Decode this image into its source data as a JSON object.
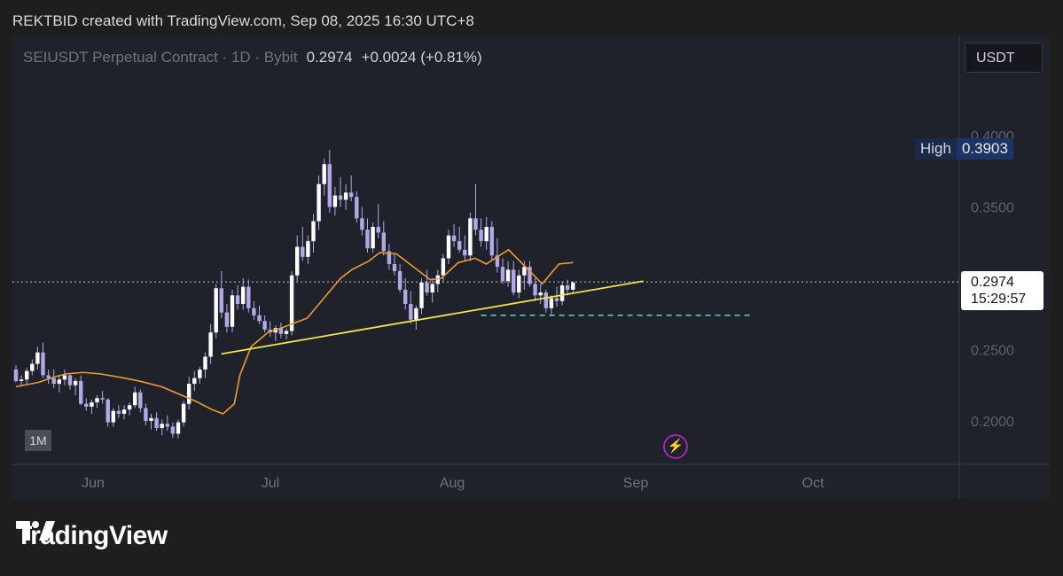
{
  "attribution": "REKTBID created with TradingView.com, Sep 08, 2025 16:30 UTC+8",
  "legend": {
    "symbol": "SEIUSDT Perpetual Contract · 1D · Bybit",
    "price": "0.2974",
    "change": "+0.0024 (+0.81%)"
  },
  "currency": "USDT",
  "high_label": "High",
  "high_value": "0.3903",
  "last_price": "0.2974",
  "countdown": "15:29:57",
  "zoom_label": "1M",
  "brand": "TradingView",
  "icons": [
    "bolt-icon",
    "tradingview-logo-icon"
  ],
  "colors": {
    "candle": "#b2a8e6",
    "ma": "#ef9a2c",
    "trendline": "#f4e34d",
    "support": "#3ed6c4",
    "price_line": "#c7c9cf"
  },
  "chart_data": {
    "type": "candlestick",
    "title": "SEIUSDT Perpetual Contract · 1D · Bybit",
    "xlabel": "",
    "ylabel": "",
    "ylim": [
      0.18,
      0.43
    ],
    "x_ticks": [
      "Jun",
      "Jul",
      "Aug",
      "Sep",
      "Oct"
    ],
    "y_ticks": [
      "0.4000",
      "0.3500",
      "0.2500",
      "0.2000"
    ],
    "grid": false,
    "series": [
      {
        "name": "",
        "type": "candle",
        "values": [
          [
            0.236,
            0.239,
            0.227,
            0.228
          ],
          [
            0.228,
            0.232,
            0.224,
            0.229
          ],
          [
            0.229,
            0.237,
            0.226,
            0.235
          ],
          [
            0.235,
            0.243,
            0.232,
            0.24
          ],
          [
            0.24,
            0.252,
            0.236,
            0.248
          ],
          [
            0.248,
            0.255,
            0.23,
            0.232
          ],
          [
            0.232,
            0.236,
            0.226,
            0.23
          ],
          [
            0.23,
            0.236,
            0.223,
            0.226
          ],
          [
            0.226,
            0.232,
            0.22,
            0.229
          ],
          [
            0.229,
            0.236,
            0.225,
            0.232
          ],
          [
            0.232,
            0.233,
            0.222,
            0.225
          ],
          [
            0.225,
            0.23,
            0.218,
            0.228
          ],
          [
            0.228,
            0.232,
            0.211,
            0.212
          ],
          [
            0.212,
            0.216,
            0.207,
            0.21
          ],
          [
            0.21,
            0.215,
            0.205,
            0.213
          ],
          [
            0.213,
            0.218,
            0.209,
            0.216
          ],
          [
            0.216,
            0.221,
            0.212,
            0.215
          ],
          [
            0.215,
            0.216,
            0.196,
            0.199
          ],
          [
            0.199,
            0.209,
            0.196,
            0.207
          ],
          [
            0.207,
            0.211,
            0.202,
            0.205
          ],
          [
            0.205,
            0.211,
            0.201,
            0.208
          ],
          [
            0.208,
            0.213,
            0.204,
            0.211
          ],
          [
            0.211,
            0.224,
            0.209,
            0.22
          ],
          [
            0.22,
            0.222,
            0.206,
            0.209
          ],
          [
            0.209,
            0.212,
            0.197,
            0.2
          ],
          [
            0.2,
            0.205,
            0.194,
            0.202
          ],
          [
            0.202,
            0.206,
            0.193,
            0.195
          ],
          [
            0.195,
            0.201,
            0.19,
            0.198
          ],
          [
            0.198,
            0.204,
            0.193,
            0.196
          ],
          [
            0.196,
            0.199,
            0.188,
            0.191
          ],
          [
            0.191,
            0.201,
            0.188,
            0.199
          ],
          [
            0.199,
            0.214,
            0.196,
            0.212
          ],
          [
            0.212,
            0.231,
            0.208,
            0.226
          ],
          [
            0.226,
            0.235,
            0.221,
            0.23
          ],
          [
            0.23,
            0.238,
            0.226,
            0.236
          ],
          [
            0.236,
            0.248,
            0.23,
            0.245
          ],
          [
            0.245,
            0.268,
            0.24,
            0.262
          ],
          [
            0.262,
            0.296,
            0.258,
            0.293
          ],
          [
            0.293,
            0.305,
            0.272,
            0.276
          ],
          [
            0.276,
            0.282,
            0.262,
            0.266
          ],
          [
            0.266,
            0.292,
            0.262,
            0.288
          ],
          [
            0.288,
            0.295,
            0.278,
            0.282
          ],
          [
            0.282,
            0.3,
            0.278,
            0.294
          ],
          [
            0.294,
            0.299,
            0.276,
            0.279
          ],
          [
            0.279,
            0.284,
            0.271,
            0.274
          ],
          [
            0.274,
            0.281,
            0.268,
            0.27
          ],
          [
            0.27,
            0.274,
            0.262,
            0.264
          ],
          [
            0.264,
            0.27,
            0.259,
            0.262
          ],
          [
            0.262,
            0.267,
            0.256,
            0.265
          ],
          [
            0.265,
            0.269,
            0.258,
            0.261
          ],
          [
            0.261,
            0.265,
            0.257,
            0.263
          ],
          [
            0.263,
            0.305,
            0.26,
            0.302
          ],
          [
            0.302,
            0.33,
            0.298,
            0.322
          ],
          [
            0.322,
            0.336,
            0.312,
            0.315
          ],
          [
            0.315,
            0.33,
            0.31,
            0.326
          ],
          [
            0.326,
            0.345,
            0.318,
            0.34
          ],
          [
            0.34,
            0.372,
            0.334,
            0.366
          ],
          [
            0.366,
            0.384,
            0.358,
            0.38
          ],
          [
            0.38,
            0.39,
            0.346,
            0.35
          ],
          [
            0.35,
            0.364,
            0.344,
            0.358
          ],
          [
            0.358,
            0.371,
            0.35,
            0.355
          ],
          [
            0.355,
            0.366,
            0.348,
            0.36
          ],
          [
            0.36,
            0.372,
            0.354,
            0.357
          ],
          [
            0.357,
            0.361,
            0.339,
            0.342
          ],
          [
            0.342,
            0.35,
            0.33,
            0.334
          ],
          [
            0.334,
            0.342,
            0.318,
            0.321
          ],
          [
            0.321,
            0.339,
            0.318,
            0.336
          ],
          [
            0.336,
            0.352,
            0.328,
            0.332
          ],
          [
            0.332,
            0.34,
            0.316,
            0.319
          ],
          [
            0.319,
            0.324,
            0.306,
            0.31
          ],
          [
            0.31,
            0.318,
            0.302,
            0.305
          ],
          [
            0.305,
            0.31,
            0.29,
            0.292
          ],
          [
            0.292,
            0.3,
            0.278,
            0.282
          ],
          [
            0.282,
            0.291,
            0.268,
            0.271
          ],
          [
            0.271,
            0.281,
            0.264,
            0.279
          ],
          [
            0.279,
            0.3,
            0.275,
            0.297
          ],
          [
            0.297,
            0.306,
            0.288,
            0.29
          ],
          [
            0.29,
            0.3,
            0.283,
            0.296
          ],
          [
            0.296,
            0.306,
            0.29,
            0.302
          ],
          [
            0.302,
            0.317,
            0.298,
            0.314
          ],
          [
            0.314,
            0.334,
            0.31,
            0.33
          ],
          [
            0.33,
            0.338,
            0.322,
            0.326
          ],
          [
            0.326,
            0.336,
            0.318,
            0.32
          ],
          [
            0.32,
            0.33,
            0.312,
            0.316
          ],
          [
            0.316,
            0.346,
            0.312,
            0.342
          ],
          [
            0.342,
            0.366,
            0.33,
            0.334
          ],
          [
            0.334,
            0.342,
            0.322,
            0.326
          ],
          [
            0.326,
            0.343,
            0.32,
            0.336
          ],
          [
            0.336,
            0.34,
            0.312,
            0.316
          ],
          [
            0.316,
            0.328,
            0.304,
            0.308
          ],
          [
            0.308,
            0.314,
            0.296,
            0.298
          ],
          [
            0.298,
            0.312,
            0.294,
            0.306
          ],
          [
            0.306,
            0.312,
            0.288,
            0.29
          ],
          [
            0.29,
            0.306,
            0.286,
            0.302
          ],
          [
            0.302,
            0.312,
            0.292,
            0.308
          ],
          [
            0.308,
            0.312,
            0.294,
            0.296
          ],
          [
            0.296,
            0.3,
            0.284,
            0.288
          ],
          [
            0.288,
            0.296,
            0.282,
            0.29
          ],
          [
            0.29,
            0.292,
            0.276,
            0.279
          ],
          [
            0.279,
            0.288,
            0.274,
            0.286
          ],
          [
            0.286,
            0.294,
            0.28,
            0.284
          ],
          [
            0.284,
            0.298,
            0.281,
            0.295
          ],
          [
            0.295,
            0.299,
            0.288,
            0.292
          ],
          [
            0.292,
            0.298,
            0.29,
            0.297
          ]
        ]
      },
      {
        "name": "",
        "type": "line",
        "values": [
          0.224,
          0.227,
          0.231,
          0.233,
          0.234,
          0.233,
          0.231,
          0.228,
          0.224,
          0.219,
          0.214,
          0.208,
          0.205,
          0.212,
          0.232,
          0.252,
          0.262,
          0.266,
          0.269,
          0.272,
          0.286,
          0.3,
          0.306,
          0.312,
          0.318,
          0.317,
          0.308,
          0.299,
          0.3,
          0.311,
          0.314,
          0.31,
          0.315,
          0.32,
          0.308,
          0.296,
          0.31,
          0.311
        ],
        "x_index": [
          0,
          8,
          14,
          18,
          24,
          30,
          36,
          44,
          52,
          58,
          64,
          70,
          74,
          78,
          80,
          84,
          90,
          96,
          100,
          104,
          110,
          116,
          120,
          126,
          130,
          136,
          142,
          148,
          152,
          158,
          164,
          168,
          172,
          176,
          182,
          188,
          194,
          199
        ]
      },
      {
        "name": "",
        "type": "trendline",
        "from": [
          0.247,
          0.262
        ],
        "to": [
          0.28,
          0.298
        ]
      },
      {
        "name": "",
        "type": "horizontal",
        "value": 0.274
      }
    ],
    "annotations": [
      {
        "label": "High",
        "value": 0.3903
      },
      {
        "label": "Last",
        "value": 0.2974
      }
    ]
  }
}
